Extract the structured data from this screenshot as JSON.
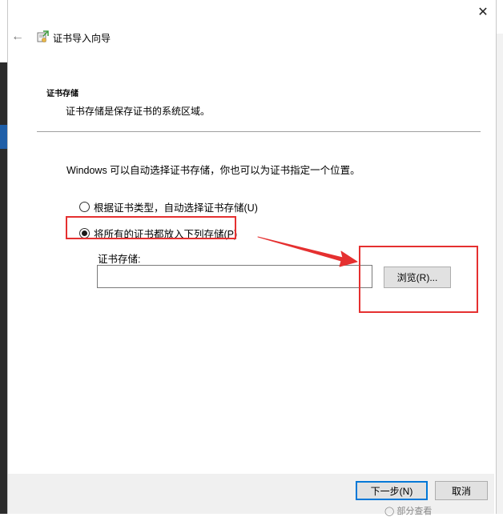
{
  "window": {
    "title": "证书导入向导",
    "close_glyph": "✕",
    "back_glyph": "←"
  },
  "section": {
    "title": "证书存储",
    "description": "证书存储是保存证书的系统区域。"
  },
  "body": {
    "intro": "Windows 可以自动选择证书存储，你也可以为证书指定一个位置。",
    "radio_auto_label": "根据证书类型，自动选择证书存储(U)",
    "radio_manual_label": "将所有的证书都放入下列存储(P)",
    "selected_option": "manual",
    "store_label": "证书存储:",
    "store_value": "",
    "browse_label": "浏览(R)..."
  },
  "footer": {
    "next_label": "下一步(N)",
    "cancel_label": "取消"
  },
  "background_peek": "◯ 部分查看",
  "annotation_color": "#e53030",
  "icons": [
    "back-arrow-icon",
    "certificate-wizard-icon",
    "close-icon"
  ]
}
